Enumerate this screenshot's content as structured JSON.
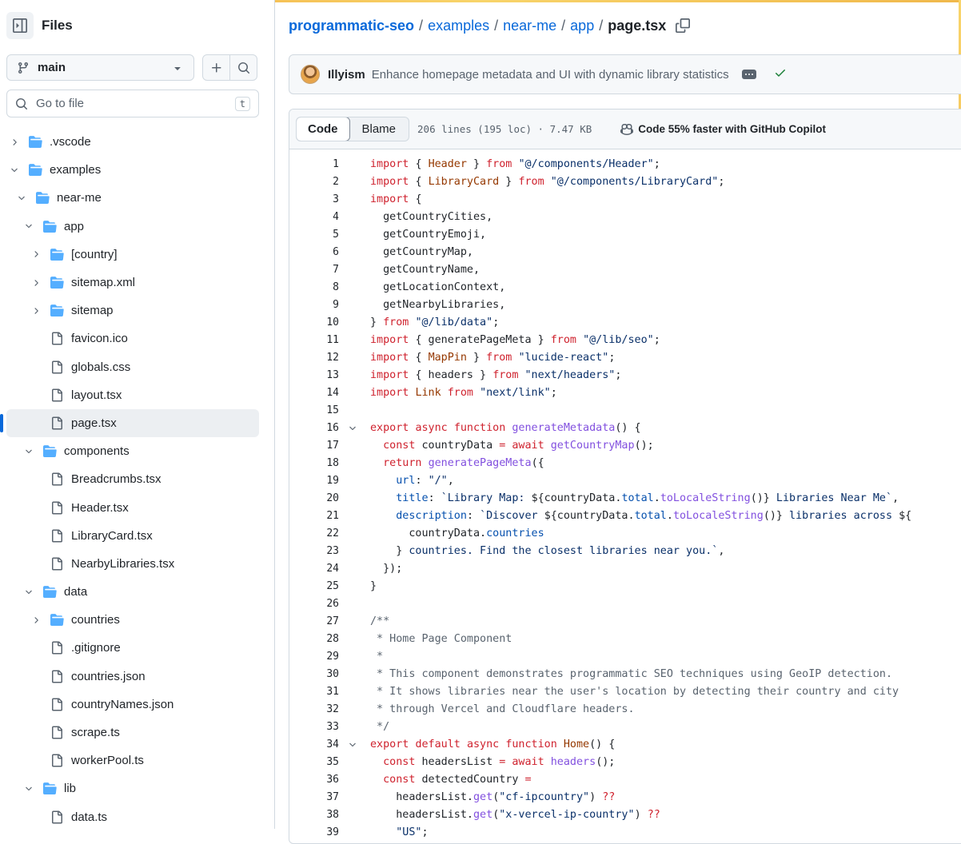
{
  "sidebar": {
    "title": "Files",
    "branch": "main",
    "goto_placeholder": "Go to file",
    "goto_shortcut": "t",
    "tree": [
      {
        "label": ".vscode",
        "type": "folder",
        "depth": 0,
        "state": "collapsed"
      },
      {
        "label": "examples",
        "type": "folder",
        "depth": 0,
        "state": "expanded"
      },
      {
        "label": "near-me",
        "type": "folder",
        "depth": 1,
        "state": "expanded"
      },
      {
        "label": "app",
        "type": "folder",
        "depth": 2,
        "state": "expanded"
      },
      {
        "label": "[country]",
        "type": "folder",
        "depth": 3,
        "state": "collapsed"
      },
      {
        "label": "sitemap.xml",
        "type": "folder",
        "depth": 3,
        "state": "collapsed"
      },
      {
        "label": "sitemap",
        "type": "folder",
        "depth": 3,
        "state": "collapsed"
      },
      {
        "label": "favicon.ico",
        "type": "file",
        "depth": 3
      },
      {
        "label": "globals.css",
        "type": "file",
        "depth": 3
      },
      {
        "label": "layout.tsx",
        "type": "file",
        "depth": 3
      },
      {
        "label": "page.tsx",
        "type": "file",
        "depth": 3,
        "selected": true
      },
      {
        "label": "components",
        "type": "folder",
        "depth": 2,
        "state": "expanded"
      },
      {
        "label": "Breadcrumbs.tsx",
        "type": "file",
        "depth": 3
      },
      {
        "label": "Header.tsx",
        "type": "file",
        "depth": 3
      },
      {
        "label": "LibraryCard.tsx",
        "type": "file",
        "depth": 3
      },
      {
        "label": "NearbyLibraries.tsx",
        "type": "file",
        "depth": 3
      },
      {
        "label": "data",
        "type": "folder",
        "depth": 2,
        "state": "expanded"
      },
      {
        "label": "countries",
        "type": "folder",
        "depth": 3,
        "state": "collapsed"
      },
      {
        "label": ".gitignore",
        "type": "file",
        "depth": 3
      },
      {
        "label": "countries.json",
        "type": "file",
        "depth": 3
      },
      {
        "label": "countryNames.json",
        "type": "file",
        "depth": 3
      },
      {
        "label": "scrape.ts",
        "type": "file",
        "depth": 3
      },
      {
        "label": "workerPool.ts",
        "type": "file",
        "depth": 3
      },
      {
        "label": "lib",
        "type": "folder",
        "depth": 2,
        "state": "expanded"
      },
      {
        "label": "data.ts",
        "type": "file",
        "depth": 3
      }
    ]
  },
  "breadcrumb": {
    "repo": "programmatic-seo",
    "parts": [
      "examples",
      "near-me",
      "app"
    ],
    "file": "page.tsx",
    "separator": "/"
  },
  "commit": {
    "author": "Illyism",
    "message": "Enhance homepage metadata and UI with dynamic library statistics"
  },
  "code_view": {
    "tab_code": "Code",
    "tab_blame": "Blame",
    "meta": "206 lines (195 loc) · 7.47 KB",
    "copilot": "Code 55% faster with GitHub Copilot",
    "lines": [
      {
        "n": "1",
        "t": [
          [
            "kw",
            "import"
          ],
          [
            "",
            "{ "
          ],
          [
            "cmp",
            "Header"
          ],
          [
            "",
            " } "
          ],
          [
            "kw",
            "from"
          ],
          [
            "",
            " "
          ],
          [
            "str",
            "\"@/components/Header\""
          ],
          [
            "",
            ";"
          ]
        ]
      },
      {
        "n": "2",
        "t": [
          [
            "kw",
            "import"
          ],
          [
            "",
            "{ "
          ],
          [
            "cmp",
            "LibraryCard"
          ],
          [
            "",
            " } "
          ],
          [
            "kw",
            "from"
          ],
          [
            "",
            " "
          ],
          [
            "str",
            "\"@/components/LibraryCard\""
          ],
          [
            "",
            ";"
          ]
        ]
      },
      {
        "n": "3",
        "t": [
          [
            "kw",
            "import"
          ],
          [
            "",
            "{"
          ]
        ]
      },
      {
        "n": "4",
        "t": [
          [
            "",
            "  getCountryCities,"
          ]
        ]
      },
      {
        "n": "5",
        "t": [
          [
            "",
            "  getCountryEmoji,"
          ]
        ]
      },
      {
        "n": "6",
        "t": [
          [
            "",
            "  getCountryMap,"
          ]
        ]
      },
      {
        "n": "7",
        "t": [
          [
            "",
            "  getCountryName,"
          ]
        ]
      },
      {
        "n": "8",
        "t": [
          [
            "",
            "  getLocationContext,"
          ]
        ]
      },
      {
        "n": "9",
        "t": [
          [
            "",
            "  getNearbyLibraries,"
          ]
        ]
      },
      {
        "n": "10",
        "t": [
          [
            "",
            "} "
          ],
          [
            "kw",
            "from"
          ],
          [
            "",
            " "
          ],
          [
            "str",
            "\"@/lib/data\""
          ],
          [
            "",
            ";"
          ]
        ]
      },
      {
        "n": "11",
        "t": [
          [
            "kw",
            "import"
          ],
          [
            "",
            "{ generatePageMeta } "
          ],
          [
            "kw",
            "from"
          ],
          [
            "",
            " "
          ],
          [
            "str",
            "\"@/lib/seo\""
          ],
          [
            "",
            ";"
          ]
        ]
      },
      {
        "n": "12",
        "t": [
          [
            "kw",
            "import"
          ],
          [
            "",
            "{ "
          ],
          [
            "cmp",
            "MapPin"
          ],
          [
            "",
            " } "
          ],
          [
            "kw",
            "from"
          ],
          [
            "",
            " "
          ],
          [
            "str",
            "\"lucide-react\""
          ],
          [
            "",
            ";"
          ]
        ]
      },
      {
        "n": "13",
        "t": [
          [
            "kw",
            "import"
          ],
          [
            "",
            "{ headers } "
          ],
          [
            "kw",
            "from"
          ],
          [
            "",
            " "
          ],
          [
            "str",
            "\"next/headers\""
          ],
          [
            "",
            ";"
          ]
        ]
      },
      {
        "n": "14",
        "t": [
          [
            "kw",
            "import"
          ],
          [
            "",
            " "
          ],
          [
            "cmp",
            "Link"
          ],
          [
            "",
            " "
          ],
          [
            "kw",
            "from"
          ],
          [
            "",
            " "
          ],
          [
            "str",
            "\"next/link\""
          ],
          [
            "",
            ";"
          ]
        ]
      },
      {
        "n": "15",
        "t": []
      },
      {
        "n": "16",
        "fold": true,
        "t": [
          [
            "kw",
            "export"
          ],
          [
            "",
            " "
          ],
          [
            "kw",
            "async"
          ],
          [
            "",
            " "
          ],
          [
            "kw",
            "function"
          ],
          [
            "",
            " "
          ],
          [
            "fn",
            "generateMetadata"
          ],
          [
            "",
            "() {"
          ]
        ]
      },
      {
        "n": "17",
        "t": [
          [
            "",
            "  "
          ],
          [
            "kw",
            "const"
          ],
          [
            "",
            " countryData "
          ],
          [
            "kw",
            "="
          ],
          [
            "",
            " "
          ],
          [
            "kw",
            "await"
          ],
          [
            "",
            " "
          ],
          [
            "fn",
            "getCountryMap"
          ],
          [
            "",
            "();"
          ]
        ]
      },
      {
        "n": "18",
        "t": [
          [
            "",
            "  "
          ],
          [
            "kw",
            "return"
          ],
          [
            "",
            " "
          ],
          [
            "fn",
            "generatePageMeta"
          ],
          [
            "",
            "({"
          ]
        ]
      },
      {
        "n": "19",
        "t": [
          [
            "",
            "    "
          ],
          [
            "prop",
            "url"
          ],
          [
            "",
            ": "
          ],
          [
            "str",
            "\"/\""
          ],
          [
            "",
            ","
          ]
        ]
      },
      {
        "n": "20",
        "t": [
          [
            "",
            "    "
          ],
          [
            "prop",
            "title"
          ],
          [
            "",
            ": "
          ],
          [
            "str",
            "`Library Map: "
          ],
          [
            "",
            "${countryData."
          ],
          [
            "prop",
            "total"
          ],
          [
            "",
            "."
          ],
          [
            "fn",
            "toLocaleString"
          ],
          [
            "",
            "()}"
          ],
          [
            "str",
            " Libraries Near Me`"
          ],
          [
            "",
            ","
          ]
        ]
      },
      {
        "n": "21",
        "t": [
          [
            "",
            "    "
          ],
          [
            "prop",
            "description"
          ],
          [
            "",
            ": "
          ],
          [
            "str",
            "`Discover "
          ],
          [
            "",
            "${countryData."
          ],
          [
            "prop",
            "total"
          ],
          [
            "",
            "."
          ],
          [
            "fn",
            "toLocaleString"
          ],
          [
            "",
            "()}"
          ],
          [
            "str",
            " libraries across "
          ],
          [
            "",
            "${"
          ]
        ]
      },
      {
        "n": "22",
        "t": [
          [
            "",
            "      countryData."
          ],
          [
            "prop",
            "countries"
          ]
        ]
      },
      {
        "n": "23",
        "t": [
          [
            "",
            "    }"
          ],
          [
            "str",
            " countries. Find the closest libraries near you.`"
          ],
          [
            "",
            ","
          ]
        ]
      },
      {
        "n": "24",
        "t": [
          [
            "",
            "  });"
          ]
        ]
      },
      {
        "n": "25",
        "t": [
          [
            "",
            "}"
          ]
        ]
      },
      {
        "n": "26",
        "t": []
      },
      {
        "n": "27",
        "t": [
          [
            "com",
            "/**"
          ]
        ]
      },
      {
        "n": "28",
        "t": [
          [
            "com",
            " * Home Page Component"
          ]
        ]
      },
      {
        "n": "29",
        "t": [
          [
            "com",
            " *"
          ]
        ]
      },
      {
        "n": "30",
        "t": [
          [
            "com",
            " * This component demonstrates programmatic SEO techniques using GeoIP detection."
          ]
        ]
      },
      {
        "n": "31",
        "t": [
          [
            "com",
            " * It shows libraries near the user's location by detecting their country and city"
          ]
        ]
      },
      {
        "n": "32",
        "t": [
          [
            "com",
            " * through Vercel and Cloudflare headers."
          ]
        ]
      },
      {
        "n": "33",
        "t": [
          [
            "com",
            " */"
          ]
        ]
      },
      {
        "n": "34",
        "fold": true,
        "t": [
          [
            "kw",
            "export"
          ],
          [
            "",
            " "
          ],
          [
            "kw",
            "default"
          ],
          [
            "",
            " "
          ],
          [
            "kw",
            "async"
          ],
          [
            "",
            " "
          ],
          [
            "kw",
            "function"
          ],
          [
            "",
            " "
          ],
          [
            "cmp",
            "Home"
          ],
          [
            "",
            "() {"
          ]
        ]
      },
      {
        "n": "35",
        "t": [
          [
            "",
            "  "
          ],
          [
            "kw",
            "const"
          ],
          [
            "",
            " headersList "
          ],
          [
            "kw",
            "="
          ],
          [
            "",
            " "
          ],
          [
            "kw",
            "await"
          ],
          [
            "",
            " "
          ],
          [
            "fn",
            "headers"
          ],
          [
            "",
            "();"
          ]
        ]
      },
      {
        "n": "36",
        "t": [
          [
            "",
            "  "
          ],
          [
            "kw",
            "const"
          ],
          [
            "",
            " detectedCountry "
          ],
          [
            "kw",
            "="
          ]
        ]
      },
      {
        "n": "37",
        "t": [
          [
            "",
            "    headersList."
          ],
          [
            "fn",
            "get"
          ],
          [
            "",
            "("
          ],
          [
            "str",
            "\"cf-ipcountry\""
          ],
          [
            "",
            ") "
          ],
          [
            "kw",
            "??"
          ]
        ]
      },
      {
        "n": "38",
        "t": [
          [
            "",
            "    headersList."
          ],
          [
            "fn",
            "get"
          ],
          [
            "",
            "("
          ],
          [
            "str",
            "\"x-vercel-ip-country\""
          ],
          [
            "",
            ") "
          ],
          [
            "kw",
            "??"
          ]
        ]
      },
      {
        "n": "39",
        "t": [
          [
            "",
            "    "
          ],
          [
            "str",
            "\"US\""
          ],
          [
            "",
            ";"
          ]
        ]
      }
    ]
  },
  "colors": {
    "link": "#0969da",
    "keyword": "#cf222e",
    "string": "#0a3069",
    "function": "#8250df",
    "property": "#0550ae",
    "comment": "#59636e",
    "component": "#953800",
    "folder": "#54aeff",
    "success": "#1a7f37"
  }
}
